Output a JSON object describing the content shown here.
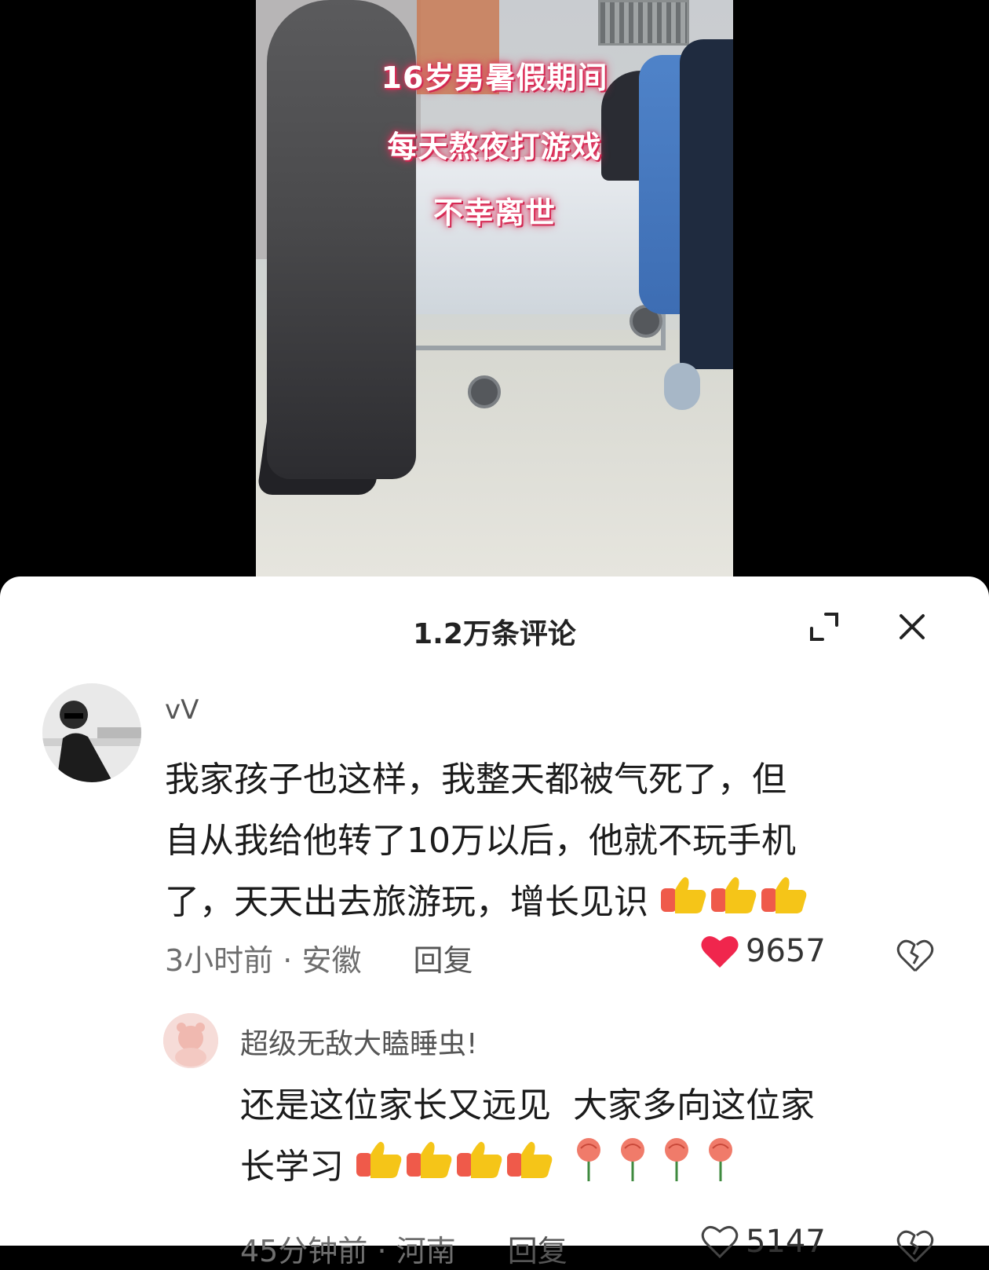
{
  "video": {
    "caption_lines": [
      "16岁男暑假期间",
      "每天熬夜打游戏",
      "不幸离世"
    ]
  },
  "comments_panel": {
    "title": "1.2万条评论",
    "expand_icon": "expand-icon",
    "close_icon": "close-icon",
    "comments": [
      {
        "author": "vV",
        "text_lines": [
          "我家孩子也这样，我整天都被气死了，但",
          "自从我给他转了10万以后，他就不玩手机",
          "了，天天出去旅游玩，增长见识"
        ],
        "time": "3小时前",
        "location": "· 安徽",
        "reply_label": "回复",
        "likes": "9657",
        "liked": true
      },
      {
        "author": "超级无敌大瞌睡虫!",
        "text_lines": [
          "还是这位家长又远见  大家多向这位家",
          "长学习"
        ],
        "time": "45分钟前",
        "location": "· 河南",
        "reply_label": "回复",
        "likes": "5147",
        "liked": false
      }
    ]
  },
  "colors": {
    "heart_liked": "#f0264d",
    "caption_glow": "#e0305a",
    "thumb_yellow": "#f5c518",
    "thumb_cuff": "#ef5a4a"
  }
}
